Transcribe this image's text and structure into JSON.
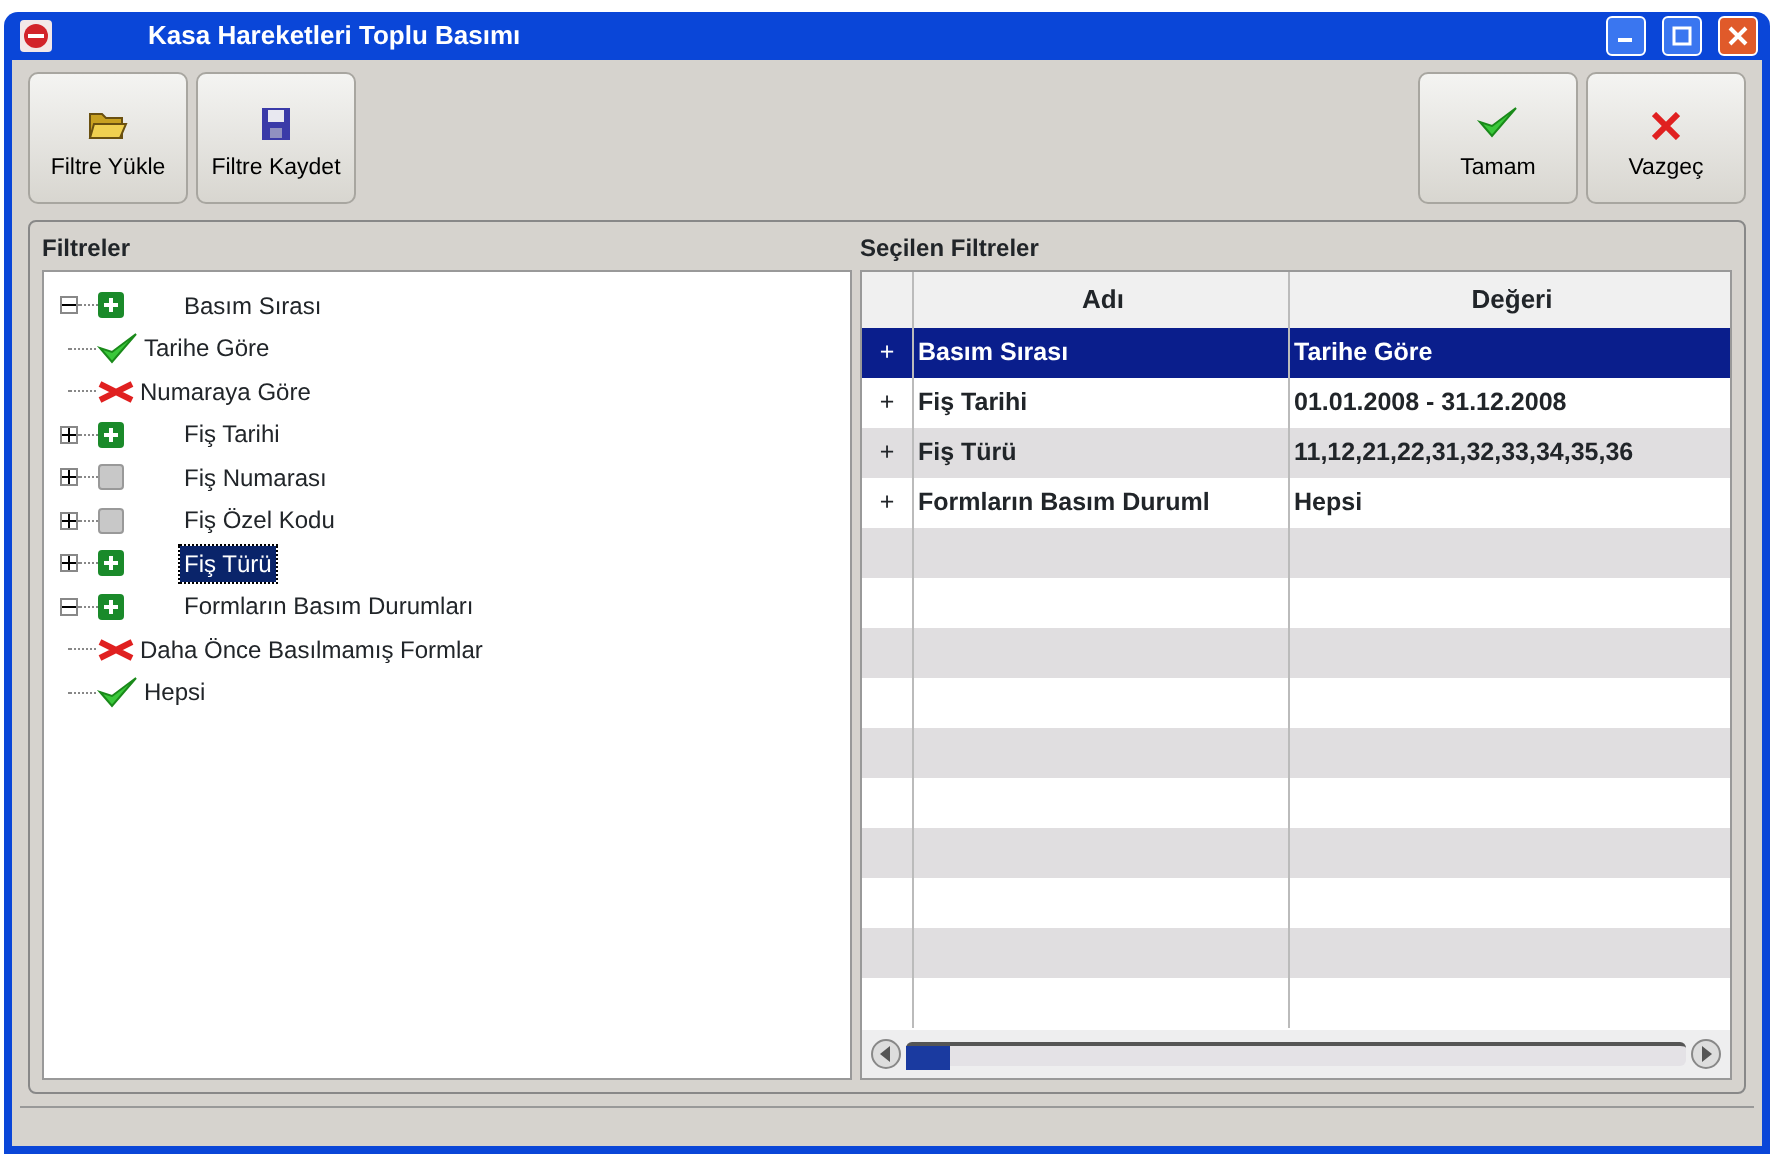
{
  "window": {
    "title": "Kasa Hareketleri Toplu Basımı"
  },
  "toolbar": {
    "left": [
      {
        "label": "Filtre Yükle",
        "kind": "load"
      },
      {
        "label": "Filtre Kaydet",
        "kind": "save"
      }
    ],
    "right": [
      {
        "label": "Tamam",
        "kind": "ok"
      },
      {
        "label": "Vazgeç",
        "kind": "cancel"
      }
    ]
  },
  "filters": {
    "title": "Filtreler",
    "tree": [
      {
        "label": "Basım Sırası",
        "active": true,
        "expanded": true,
        "selected": false,
        "children": [
          {
            "label": "Tarihe Göre",
            "included": true
          },
          {
            "label": "Numaraya Göre",
            "included": false
          }
        ]
      },
      {
        "label": "Fiş Tarihi",
        "active": true,
        "expanded": false,
        "selected": false
      },
      {
        "label": "Fiş Numarası",
        "active": false,
        "expanded": false,
        "selected": false
      },
      {
        "label": "Fiş Özel Kodu",
        "active": false,
        "expanded": false,
        "selected": false
      },
      {
        "label": "Fiş Türü",
        "active": true,
        "expanded": false,
        "selected": true
      },
      {
        "label": "Formların Basım Durumları",
        "active": true,
        "expanded": true,
        "selected": false,
        "children": [
          {
            "label": "Daha Önce Basılmamış Formlar",
            "included": false
          },
          {
            "label": "Hepsi",
            "included": true
          }
        ]
      }
    ]
  },
  "selected_filters": {
    "title": "Seçilen Filtreler",
    "columns": [
      "Adı",
      "Değeri"
    ],
    "rows": [
      {
        "marker": "+",
        "name": "Basım Sırası",
        "value": "Tarihe Göre",
        "selected": true
      },
      {
        "marker": "+",
        "name": "Fiş Tarihi",
        "value": "01.01.2008 - 31.12.2008",
        "selected": false
      },
      {
        "marker": "+",
        "name": "Fiş Türü",
        "value": "11,12,21,22,31,32,33,34,35,36",
        "selected": false
      },
      {
        "marker": "+",
        "name": "Formların Basım Duruml",
        "value": "Hepsi",
        "selected": false
      }
    ]
  }
}
